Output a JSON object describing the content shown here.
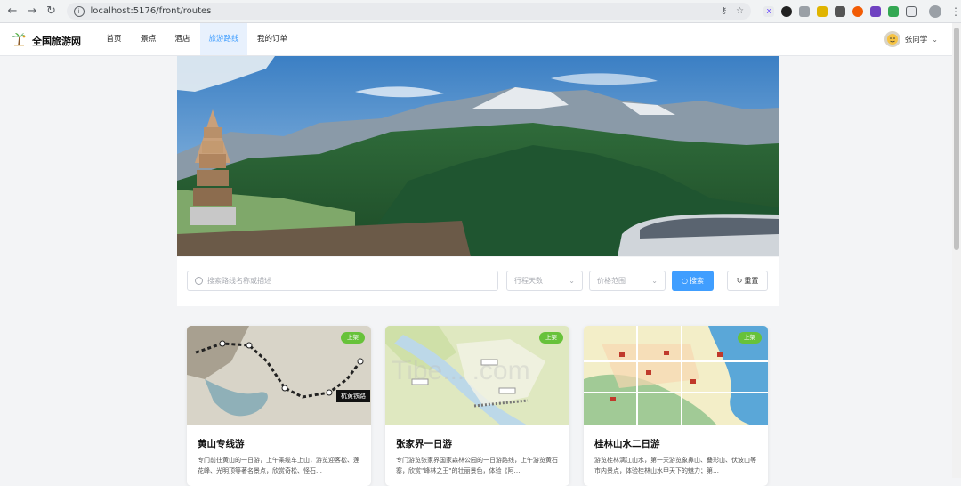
{
  "browser": {
    "url": "localhost:5176/front/routes"
  },
  "header": {
    "brand": "全国旅游网",
    "nav": [
      {
        "label": "首页",
        "active": false
      },
      {
        "label": "景点",
        "active": false
      },
      {
        "label": "酒店",
        "active": false
      },
      {
        "label": "旅游路线",
        "active": true
      },
      {
        "label": "我的订单",
        "active": false
      }
    ],
    "user_name": "张同学"
  },
  "search": {
    "placeholder": "搜索路线名称或描述",
    "days_placeholder": "行程天数",
    "price_placeholder": "价格范围",
    "search_label": "搜索",
    "reset_label": "重置"
  },
  "cards": [
    {
      "badge": "上架",
      "title": "黄山专线游",
      "desc": "专门前往黄山的一日游，上午乘缆车上山，游览迎客松、莲花峰、光明顶等著名景点，欣赏奇松、怪石…",
      "map_label": "杭黄铁路"
    },
    {
      "badge": "上架",
      "title": "张家界一日游",
      "desc": "专门游览张家界国家森林公园的一日游路线，上午游览黄石寨，欣赏\"峰林之王\"的壮丽景色，体验《阿…"
    },
    {
      "badge": "上架",
      "title": "桂林山水二日游",
      "desc": "游览桂林漓江山水，第一天游览象鼻山、叠彩山、伏波山等市内景点，体验桂林山水甲天下的魅力；第…"
    }
  ],
  "watermark": "Tibe... .com",
  "colors": {
    "primary": "#409eff",
    "badge": "#67c23a"
  }
}
